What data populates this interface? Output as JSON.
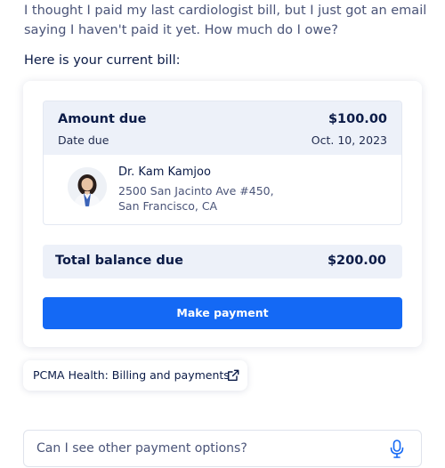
{
  "conversation": {
    "user_message": "I thought I paid my last cardiologist bill, but I just got an email saying I haven't paid it yet. How much do I owe?",
    "assistant_intro": "Here is your current bill:"
  },
  "bill": {
    "amount_due_label": "Amount due",
    "amount_due_value": "$100.00",
    "date_due_label": "Date due",
    "date_due_value": "Oct. 10, 2023",
    "provider": {
      "name": "Dr. Kam Kamjoo",
      "address_line1": "2500 San Jacinto Ave #450,",
      "address_line2": "San Francisco, CA",
      "avatar_icon": "doctor-avatar"
    },
    "total_label": "Total balance due",
    "total_value": "$200.00",
    "pay_button_label": "Make payment"
  },
  "link": {
    "label": "PCMA Health: Billing and payments",
    "icon": "external-link-icon"
  },
  "chat_input": {
    "value": "Can I see other payment options?",
    "icon": "microphone-icon"
  },
  "colors": {
    "accent": "#1469f5",
    "panel": "#edf1f9",
    "text": "#0b1b47",
    "muted": "#4a5478"
  }
}
